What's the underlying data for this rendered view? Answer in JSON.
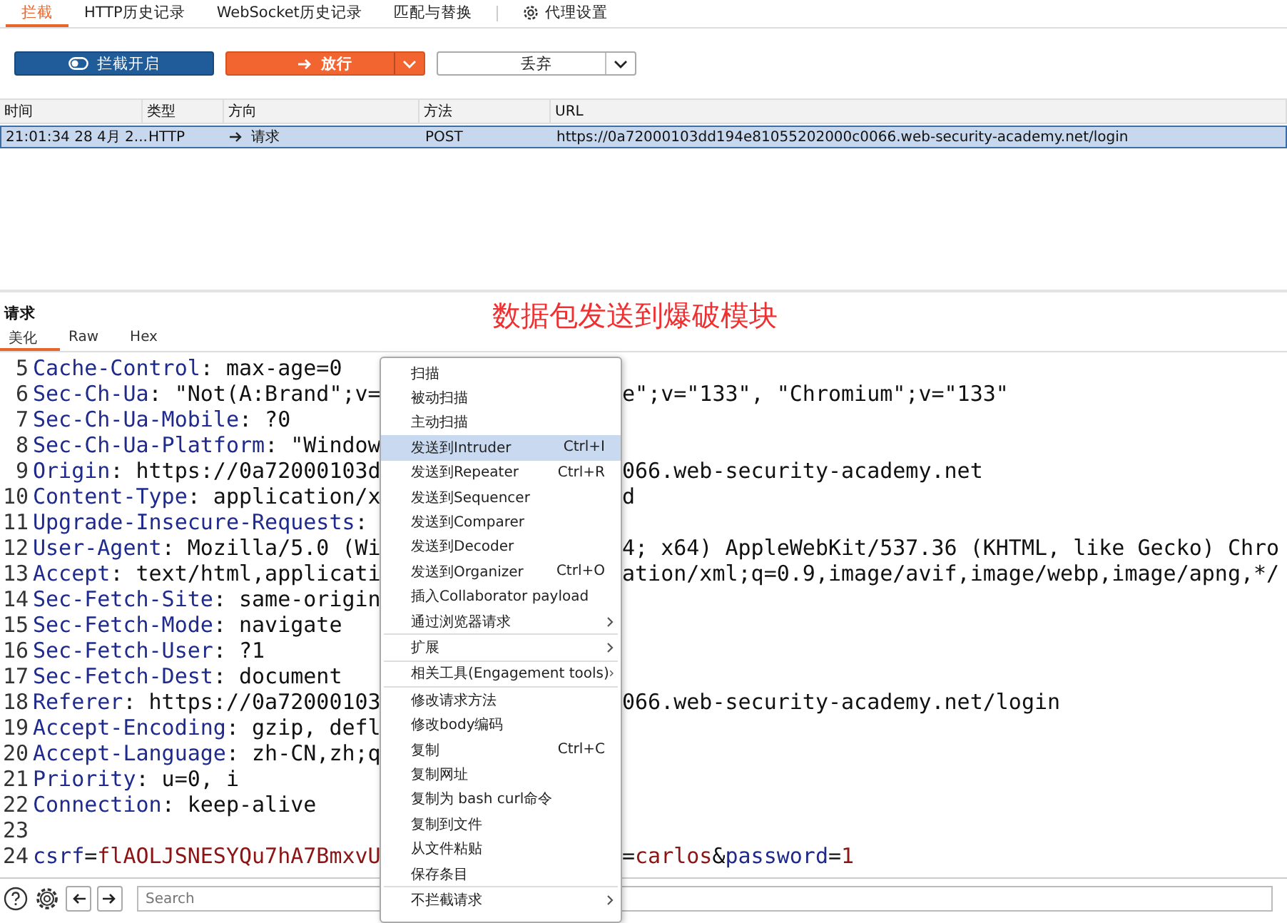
{
  "tabs": [
    {
      "label": "拦截",
      "selected": true,
      "kind": "tab"
    },
    {
      "label": "HTTP历史记录",
      "selected": false,
      "kind": "tab"
    },
    {
      "label": "WebSocket历史记录",
      "selected": false,
      "kind": "tab"
    },
    {
      "label": "匹配与替换",
      "selected": false,
      "kind": "tab"
    },
    {
      "label": "代理设置",
      "selected": false,
      "kind": "settings"
    }
  ],
  "buttons": [
    {
      "label": "拦截开启",
      "kind": "toggle"
    },
    {
      "label": "放行",
      "kind": "forward"
    },
    {
      "label": "丢弃",
      "kind": "drop"
    }
  ],
  "table": {
    "columns": [
      "时间",
      "类型",
      "方向",
      "方法",
      "URL"
    ],
    "rows": [
      {
        "time": "21:01:34 28 4月 2...",
        "type": "HTTP",
        "direction": "请求",
        "method": "POST",
        "url": "https://0a72000103dd194e81055202000c0066.web-security-academy.net/login",
        "selected": true
      }
    ]
  },
  "request_panel": {
    "title": "请求",
    "annotation": "数据包发送到爆破模块",
    "tabs": [
      {
        "label": "美化",
        "selected": true
      },
      {
        "label": "Raw",
        "selected": false
      },
      {
        "label": "Hex",
        "selected": false
      }
    ],
    "lines": [
      {
        "num": "5",
        "left": [
          {
            "kind": "key",
            "text": "Cache-Control"
          },
          {
            "kind": "text",
            "text": ": max-age=0"
          }
        ]
      },
      {
        "num": "6",
        "left": [
          {
            "kind": "key",
            "text": "Sec-Ch-Ua"
          },
          {
            "kind": "text",
            "text": ": \"Not(A:Brand\";v="
          }
        ],
        "right": [
          {
            "kind": "text",
            "text": "e\";v=\"133\", \"Chromium\";v=\"133\""
          }
        ]
      },
      {
        "num": "7",
        "left": [
          {
            "kind": "key",
            "text": "Sec-Ch-Ua-Mobile"
          },
          {
            "kind": "text",
            "text": ": ?0"
          }
        ]
      },
      {
        "num": "8",
        "left": [
          {
            "kind": "key",
            "text": "Sec-Ch-Ua-Platform"
          },
          {
            "kind": "text",
            "text": ": \"Window"
          }
        ]
      },
      {
        "num": "9",
        "left": [
          {
            "kind": "key",
            "text": "Origin"
          },
          {
            "kind": "text",
            "text": ": https://0a72000103d"
          }
        ],
        "right": [
          {
            "kind": "text",
            "text": "066.web-security-academy.net"
          }
        ]
      },
      {
        "num": "10",
        "left": [
          {
            "kind": "key",
            "text": "Content-Type"
          },
          {
            "kind": "text",
            "text": ": application/x"
          }
        ],
        "right": [
          {
            "kind": "text",
            "text": "d"
          }
        ]
      },
      {
        "num": "11",
        "left": [
          {
            "kind": "key",
            "text": "Upgrade-Insecure-Requests"
          },
          {
            "kind": "text",
            "text": ":"
          }
        ]
      },
      {
        "num": "12",
        "left": [
          {
            "kind": "key",
            "text": "User-Agent"
          },
          {
            "kind": "text",
            "text": ": Mozilla/5.0 (Wi"
          }
        ],
        "right": [
          {
            "kind": "text",
            "text": "4; x64) AppleWebKit/537.36 (KHTML, like Gecko) Chro"
          }
        ]
      },
      {
        "num": "13",
        "left": [
          {
            "kind": "key",
            "text": "Accept"
          },
          {
            "kind": "text",
            "text": ": text/html,applicati"
          }
        ],
        "right": [
          {
            "kind": "text",
            "text": "ation/xml;q=0.9,image/avif,image/webp,image/apng,*/"
          }
        ]
      },
      {
        "num": "14",
        "left": [
          {
            "kind": "key",
            "text": "Sec-Fetch-Site"
          },
          {
            "kind": "text",
            "text": ": same-origin"
          }
        ]
      },
      {
        "num": "15",
        "left": [
          {
            "kind": "key",
            "text": "Sec-Fetch-Mode"
          },
          {
            "kind": "text",
            "text": ": navigate"
          }
        ]
      },
      {
        "num": "16",
        "left": [
          {
            "kind": "key",
            "text": "Sec-Fetch-User"
          },
          {
            "kind": "text",
            "text": ": ?1"
          }
        ]
      },
      {
        "num": "17",
        "left": [
          {
            "kind": "key",
            "text": "Sec-Fetch-Dest"
          },
          {
            "kind": "text",
            "text": ": document"
          }
        ]
      },
      {
        "num": "18",
        "left": [
          {
            "kind": "key",
            "text": "Referer"
          },
          {
            "kind": "text",
            "text": ": https://0a72000103"
          }
        ],
        "right": [
          {
            "kind": "text",
            "text": "066.web-security-academy.net/login"
          }
        ]
      },
      {
        "num": "19",
        "left": [
          {
            "kind": "key",
            "text": "Accept-Encoding"
          },
          {
            "kind": "text",
            "text": ": gzip, defl"
          }
        ]
      },
      {
        "num": "20",
        "left": [
          {
            "kind": "key",
            "text": "Accept-Language"
          },
          {
            "kind": "text",
            "text": ": zh-CN,zh;q"
          }
        ]
      },
      {
        "num": "21",
        "left": [
          {
            "kind": "key",
            "text": "Priority"
          },
          {
            "kind": "text",
            "text": ": u=0, i"
          }
        ]
      },
      {
        "num": "22",
        "left": [
          {
            "kind": "key",
            "text": "Connection"
          },
          {
            "kind": "text",
            "text": ": keep-alive"
          }
        ]
      },
      {
        "num": "23"
      },
      {
        "num": "24",
        "left": [
          {
            "kind": "key",
            "text": "csrf"
          },
          {
            "kind": "text",
            "text": "="
          },
          {
            "kind": "value",
            "text": "flAOLJSNESYQu7hA7BmxvU"
          }
        ],
        "right": [
          {
            "kind": "text",
            "text": "="
          },
          {
            "kind": "value",
            "text": "carlos"
          },
          {
            "kind": "text",
            "text": "&"
          },
          {
            "kind": "key",
            "text": "password"
          },
          {
            "kind": "text",
            "text": "="
          },
          {
            "kind": "value",
            "text": "1"
          }
        ]
      }
    ]
  },
  "context_menu": {
    "items": [
      {
        "kind": "item",
        "label": "扫描",
        "selected": false
      },
      {
        "kind": "item",
        "label": "被动扫描",
        "selected": false
      },
      {
        "kind": "item",
        "label": "主动扫描",
        "selected": false
      },
      {
        "kind": "item",
        "label": "发送到Intruder",
        "shortcut": "Ctrl+I",
        "selected": true
      },
      {
        "kind": "item",
        "label": "发送到Repeater",
        "shortcut": "Ctrl+R",
        "selected": false
      },
      {
        "kind": "item",
        "label": "发送到Sequencer",
        "selected": false
      },
      {
        "kind": "item",
        "label": "发送到Comparer",
        "selected": false
      },
      {
        "kind": "item",
        "label": "发送到Decoder",
        "selected": false
      },
      {
        "kind": "item",
        "label": "发送到Organizer",
        "shortcut": "Ctrl+O",
        "selected": false
      },
      {
        "kind": "item",
        "label": "插入Collaborator payload",
        "selected": false
      },
      {
        "kind": "item",
        "label": "通过浏览器请求",
        "submenu": true,
        "selected": false
      },
      {
        "kind": "separator"
      },
      {
        "kind": "item",
        "label": "扩展",
        "submenu": true,
        "selected": false
      },
      {
        "kind": "separator"
      },
      {
        "kind": "item",
        "label": "相关工具(Engagement tools)",
        "submenu": true,
        "selected": false
      },
      {
        "kind": "separator"
      },
      {
        "kind": "item",
        "label": "修改请求方法",
        "selected": false
      },
      {
        "kind": "item",
        "label": "修改body编码",
        "selected": false
      },
      {
        "kind": "item",
        "label": "复制",
        "shortcut": "Ctrl+C",
        "selected": false
      },
      {
        "kind": "item",
        "label": "复制网址",
        "selected": false
      },
      {
        "kind": "item",
        "label": "复制为 bash curl命令",
        "selected": false
      },
      {
        "kind": "item",
        "label": "复制到文件",
        "selected": false
      },
      {
        "kind": "item",
        "label": "从文件粘贴",
        "selected": false
      },
      {
        "kind": "item",
        "label": "保存条目",
        "selected": false
      },
      {
        "kind": "separator"
      },
      {
        "kind": "item",
        "label": "不拦截请求",
        "submenu": true,
        "selected": false
      }
    ]
  },
  "bottom_bar": {
    "search": {
      "placeholder": "Search"
    }
  }
}
